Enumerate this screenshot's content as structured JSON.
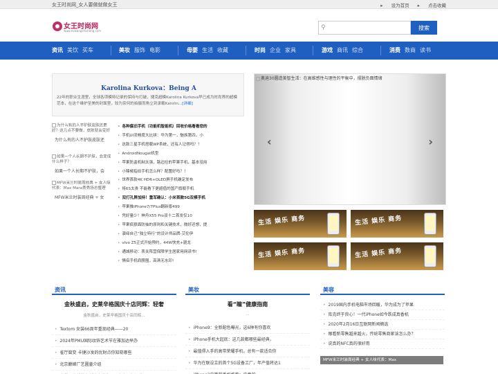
{
  "topbar": {
    "site_name": "女王时尚网_女人要做就做女王",
    "set_home": "设为首页",
    "favorite": "点击收藏"
  },
  "logo": {
    "name": "女王时尚网",
    "url": "www.nvwangshishang.com"
  },
  "search": {
    "placeholder": "",
    "button": "搜索"
  },
  "nav": [
    {
      "group": "资讯",
      "subs": [
        "美饮",
        "买车"
      ]
    },
    {
      "group": "美妆",
      "subs": [
        "服饰",
        "电影"
      ]
    },
    {
      "group": "母婴",
      "subs": [
        "生活",
        "收藏"
      ]
    },
    {
      "group": "时尚",
      "subs": [
        "企业",
        "家具"
      ]
    },
    {
      "group": "游戏",
      "subs": [
        "商讯",
        "综合"
      ]
    },
    {
      "group": "消费",
      "subs": [
        "数商",
        "读书"
      ]
    }
  ],
  "feature": {
    "title": "Karolina Kurkova：Being A",
    "desc": "22年的职业生涯里，全球各项模特记录的保持与打破，捷克超模Karolina Kurkova早已成为时尚界的超模范本，在这个维护至美的封面里，较为奈何的拍摄而角立到承载Karolin...",
    "more": "[详细]"
  },
  "left_images": [
    {
      "alt": "为什么有的人不护肤皮肤还更好？这几点不要做，皮肤就会变好",
      "caption": "为什么有的人不护肤皮肤还"
    },
    {
      "alt": "如果一个人长期不护肤，会变成什么样子？",
      "caption": "如果一个人长期不护肤，会"
    },
    {
      "alt": "MFW米兰时装周经典 + 女人味代表：Max Mara秀秀场总整理",
      "caption": "MFW米兰时装周经典 + 女"
    }
  ],
  "news": [
    {
      "text": "各种腐旧手机（功能机智能机）回收价格看看您的",
      "bold": true
    },
    {
      "text": "手机UI流畅度大比拼：华为第一，魅族第四，小",
      "bold": false
    },
    {
      "text": "这款三星手机搭载WP系统，还有人记得吗？！",
      "bold": false
    },
    {
      "text": "AndroidNougat机型",
      "bold": false
    },
    {
      "text": "苹果防盗机制太强，路边捡的苹果手机，基本没用",
      "bold": false
    },
    {
      "text": "小辣椒指纹手机怎么样？配置好吗？！",
      "bold": false
    },
    {
      "text": "世界首款4K HDR+OLED屏手机确定发布",
      "bold": false
    },
    {
      "text": "将6S太贵 不能看下更超值的国产旗舰手机",
      "bold": false
    },
    {
      "text": "双打孔屏加持！重军确认：小米首款5G双模手机",
      "bold": true
    },
    {
      "text": "苹果推iPhone7/7Plus翻新版499",
      "bold": false
    },
    {
      "text": "凭好量少！神舟X55 Pro双十二首发仅10",
      "bold": false
    },
    {
      "text": "苹果疯狼面防抽的原则和关键技术，微好还想，提",
      "bold": false
    },
    {
      "text": "演绎自己“独立特行”的设计师品牌-艾伦伊",
      "bold": false
    },
    {
      "text": "vivo Z5正式开始预约，44W快充+骁龙",
      "bold": false
    },
    {
      "text": "通城移动：表关阵营保障学生居家用网读书!",
      "bold": false
    },
    {
      "text": "情侣手机肩膀围，高清无水印!",
      "bold": false
    }
  ],
  "slider": {
    "caption": "奥迪30圆造美智生活：在高维感性与理性的平衡中，摆脱负面情绪",
    "prev": "‹",
    "next": "›"
  },
  "tiles": [
    {
      "words": "生活 娱乐 商务"
    },
    {
      "words": "生活 娱乐 商务"
    },
    {
      "words": "生活 娱乐 商务"
    },
    {
      "words": "生活 娱乐 商务"
    }
  ],
  "sections": {
    "left": {
      "header": "资讯",
      "title": "金秋盛启，史莱辛格国庆十店同辉：轻奢",
      "subtitle": "金秋盛启，史莱辛格国庆十店同辉...",
      "rows": [
        "Textom 女装66周年重现经典——20",
        "2024年PMU国际纹饰艺术节在雅加达举办",
        "雀厅腐变 卡捷沙发的优财点你知晓哪些",
        "北京巅峰厂艺圆童介组",
        "鸟巢品类新装在新地大学生国展立金只舞切件"
      ]
    },
    "middle": {
      "header": "美妆",
      "title": "看“瞳”健康指南",
      "subtitle": "...",
      "rows": [
        "iPhone9：全新配色曝光，这6种有你喜欢",
        "iPhone手机大起底：这几款都哪些最经典，",
        "最值得入手的高带荣耀手机，总有一款适合你",
        "华为在联设立的首个5G设备工厂，年产值将达1",
        "iPhone2中等款手机推荐：中意的…"
      ]
    },
    "right": {
      "header": "美容",
      "rows": [
        "2019国内手机电脑市场回暖，华为成为了苹果",
        "库克终于良心！一代iPhone如今跌成真香机",
        "2020年2月16日互联网新闻摘选",
        "眼看新零售越来越火，传统零售商家该怎么办？",
        "说真的NFC真的很好用"
      ],
      "overlay": "MFW米兰时装周经典 + 女人味代表：Max"
    }
  }
}
